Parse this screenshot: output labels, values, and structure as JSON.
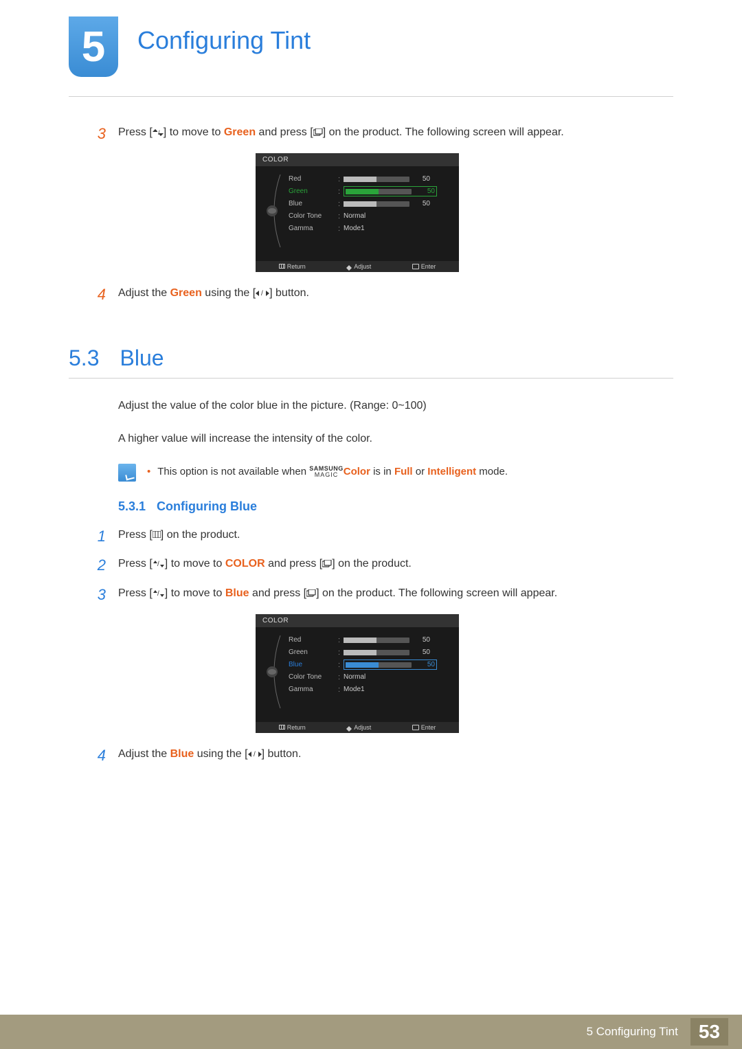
{
  "chapter": {
    "number": "5",
    "title": "Configuring Tint"
  },
  "green_steps": {
    "step3_pre": "Press [",
    "step3_mid1": "] to move to ",
    "step3_green": "Green",
    "step3_mid2": " and press [",
    "step3_post": "] on the product. The following screen will appear.",
    "step4_pre": "Adjust the ",
    "step4_green": "Green",
    "step4_mid": " using the [",
    "step4_post": "] button."
  },
  "osd": {
    "title": "COLOR",
    "rows": {
      "red": {
        "label": "Red",
        "value": "50"
      },
      "green": {
        "label": "Green",
        "value": "50"
      },
      "blue": {
        "label": "Blue",
        "value": "50"
      },
      "tone": {
        "label": "Color Tone",
        "value": "Normal"
      },
      "gamma": {
        "label": "Gamma",
        "value": "Mode1"
      }
    },
    "footer": {
      "return": "Return",
      "adjust": "Adjust",
      "enter": "Enter"
    }
  },
  "section": {
    "num": "5.3",
    "title": "Blue",
    "p1": "Adjust the value of the color blue in the picture. (Range: 0~100)",
    "p2": "A higher value will increase the intensity of the color."
  },
  "note": {
    "pre": "This option is not available when ",
    "magic_top": "SAMSUNG",
    "magic_bot": "MAGIC",
    "color_word": "Color",
    "mid": " is in ",
    "full": "Full",
    "or": " or ",
    "intelligent": "Intelligent",
    "post": " mode."
  },
  "subsection": {
    "num": "5.3.1",
    "title": "Configuring Blue"
  },
  "blue_steps": {
    "s1_pre": "Press [",
    "s1_post": "] on the product.",
    "s2_pre": "Press [",
    "s2_mid1": "] to move to ",
    "s2_color": "COLOR",
    "s2_mid2": " and press [",
    "s2_post": "] on the product.",
    "s3_pre": "Press [",
    "s3_mid1": "] to move to ",
    "s3_blue": "Blue",
    "s3_mid2": " and press [",
    "s3_post": "] on the product. The following screen will appear.",
    "s4_pre": "Adjust the ",
    "s4_blue": "Blue",
    "s4_mid": " using the [",
    "s4_post": "] button."
  },
  "footer": {
    "text": "5 Configuring Tint",
    "page": "53"
  }
}
